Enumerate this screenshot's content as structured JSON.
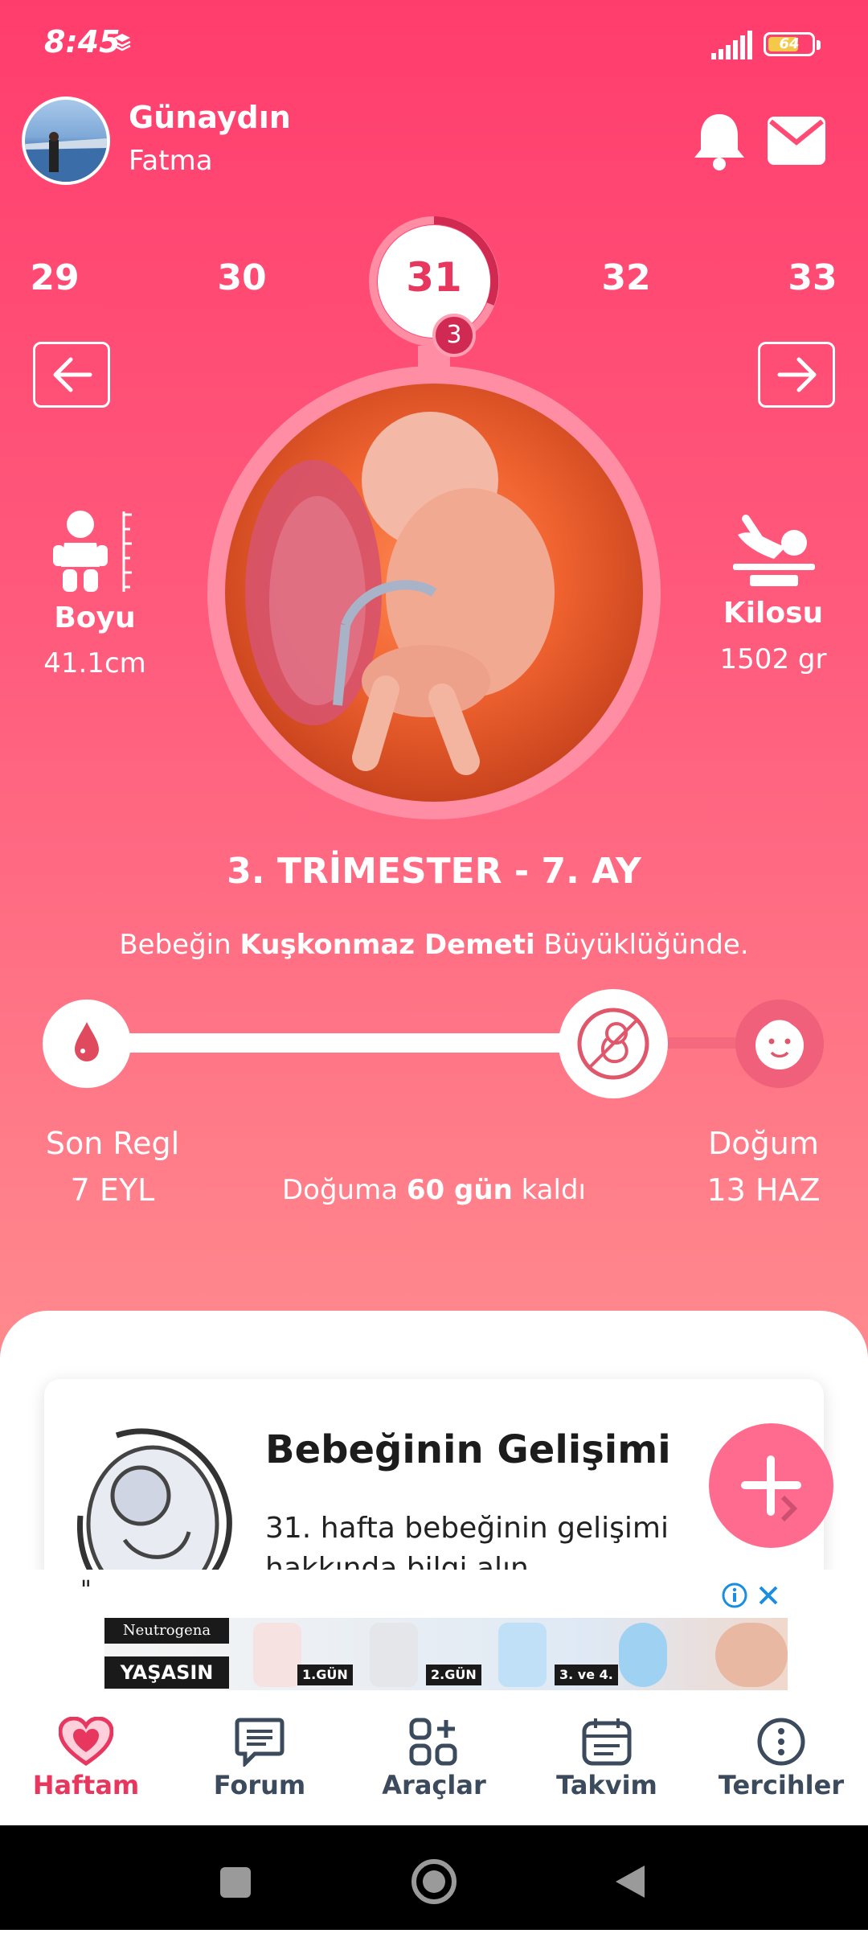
{
  "status": {
    "time": "8:45",
    "battery": "64"
  },
  "header": {
    "greeting": "Günaydın",
    "name": "Fatma"
  },
  "weeks": {
    "items": [
      "29",
      "30",
      "31",
      "32",
      "33"
    ],
    "active": "31",
    "day": "3"
  },
  "stats": {
    "height_label": "Boyu",
    "height_value": "41.1cm",
    "weight_label": "Kilosu",
    "weight_value": "1502 gr"
  },
  "trimester": "3. TRİMESTER - 7. AY",
  "size": {
    "prefix": "Bebeğin",
    "fruit": "Kuşkonmaz Demeti",
    "suffix": "Büyüklüğünde."
  },
  "timeline": {
    "start_label": "Son Regl",
    "start_date": "7 EYL",
    "end_label": "Doğum",
    "end_date": "13 HAZ",
    "countdown_prefix": "Doğuma",
    "countdown_days": "60 gün",
    "countdown_suffix": "kaldı",
    "progress": 0.78
  },
  "card": {
    "title": "Bebeğinin Gelişimi",
    "line1": "31. hafta bebeğinin gelişimi",
    "line2": "hakkında bilgi alın"
  },
  "ad": {
    "quote": "\"",
    "brand": "Neutrogena",
    "headline": "YAŞASIN",
    "steps": [
      "1.GÜN",
      "2.GÜN",
      "3. ve 4."
    ]
  },
  "nav": [
    {
      "label": "Haftam"
    },
    {
      "label": "Forum"
    },
    {
      "label": "Araçlar"
    },
    {
      "label": "Takvim"
    },
    {
      "label": "Tercihler"
    }
  ],
  "colors": {
    "accent": "#e8375f",
    "hero_top": "#ff3d6d",
    "hero_bottom": "#ff8a8e",
    "fab": "#ff6b8e"
  }
}
